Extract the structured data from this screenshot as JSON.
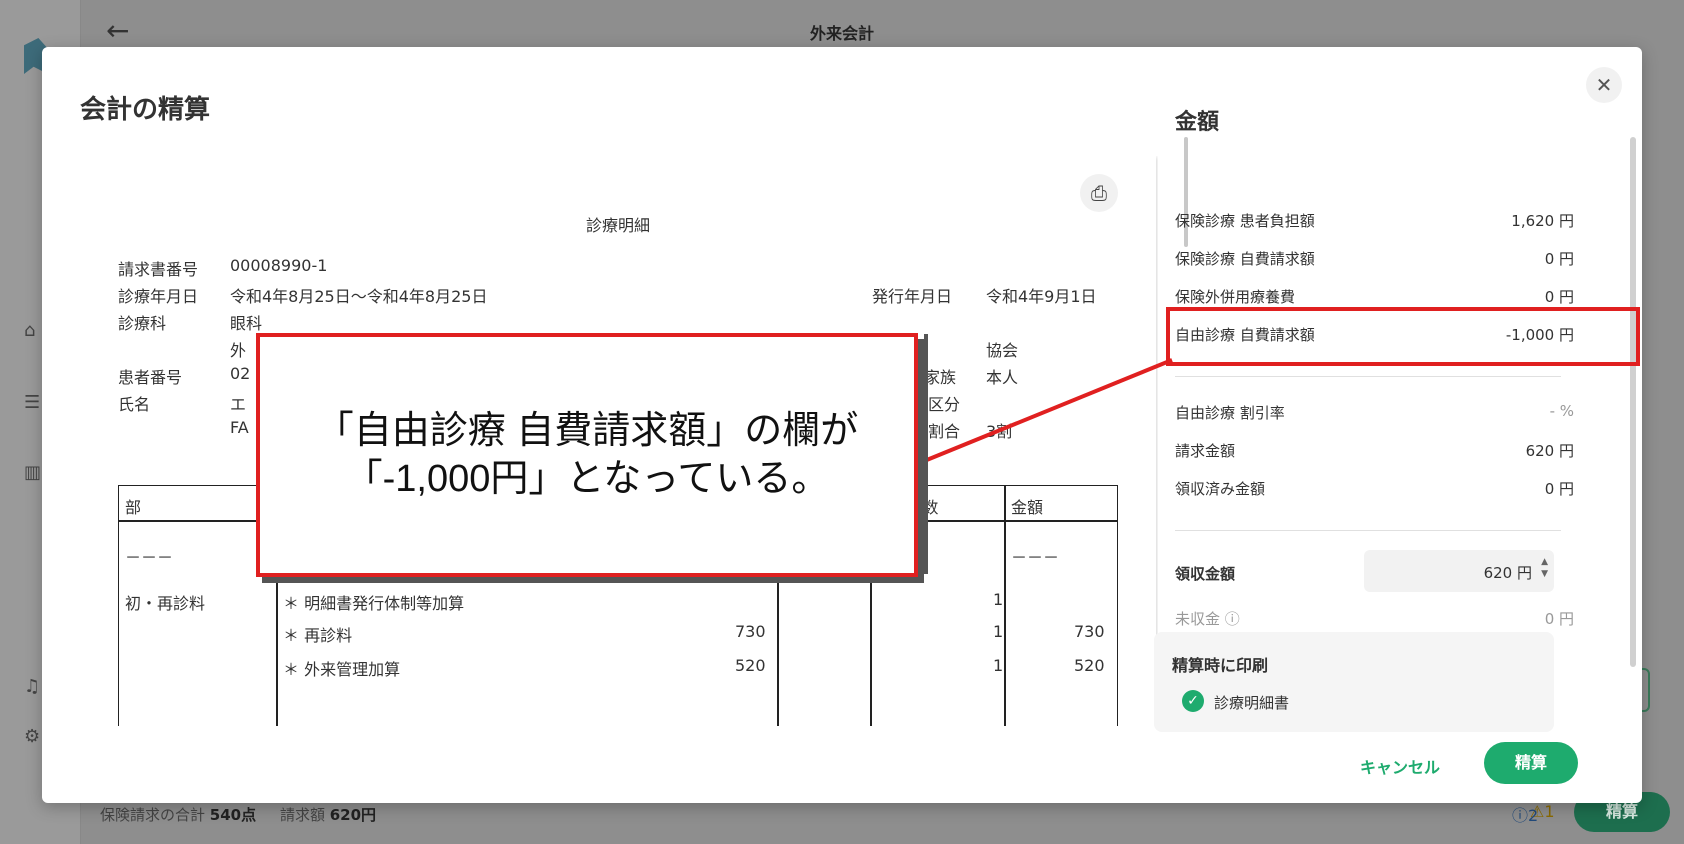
{
  "background": {
    "title": "外来会計",
    "footer": {
      "claim_total_label": "保険請求の合計",
      "claim_total_value": "540点",
      "billed_label": "請求額",
      "billed_value": "620円",
      "warn_count": "1",
      "info_count": "2",
      "settle_label": "精算"
    }
  },
  "modal": {
    "title": "会計の精算",
    "close_icon": "✕"
  },
  "document": {
    "heading": "診療明細",
    "invoice_no_label": "請求書番号",
    "invoice_no": "00008990-1",
    "date_label": "診療年月日",
    "date_value": "令和4年8月25日〜令和4年8月25日",
    "issue_label": "発行年月日",
    "issue_value": "令和4年9月1日",
    "dept_label": "診療科",
    "dept_value": "眼科",
    "dept_value2": "外",
    "kyokai": "協会",
    "patient_no_label": "患者番号",
    "patient_no_partial": "02",
    "family_label": "・家族",
    "family_value": "本人",
    "name_label": "氏名",
    "name_partial": "エ",
    "name_partial2": "FA",
    "kubun": "区分",
    "ratio_label": "割合",
    "ratio_value": "3割",
    "table": {
      "col1": "部",
      "col_count": "/回数",
      "col_amount": "金額",
      "dash": "－－－",
      "rows": [
        {
          "section": "初・再診料",
          "item": "＊ 明細書発行体制等加算",
          "points": "",
          "count": "1",
          "amount": ""
        },
        {
          "section": "",
          "item": "＊ 再診料",
          "points": "730",
          "count": "1",
          "amount": "730"
        },
        {
          "section": "",
          "item": "＊ 外来管理加算",
          "points": "520",
          "count": "1",
          "amount": "520"
        }
      ]
    }
  },
  "amounts": {
    "title": "金額",
    "items": [
      {
        "label": "保険診療 患者負担額",
        "value": "1,620 円"
      },
      {
        "label": "保険診療 自費請求額",
        "value": "0 円"
      },
      {
        "label": "保険外併用療養費",
        "value": "0 円"
      },
      {
        "label": "自由診療 自費請求額",
        "value": "-1,000 円"
      },
      {
        "label": "自由診療 割引率",
        "value": "- %"
      },
      {
        "label": "請求金額",
        "value": "620 円"
      },
      {
        "label": "領収済み金額",
        "value": "0 円"
      }
    ],
    "receipt_label": "領収金額",
    "receipt_value": "620 円",
    "unpaid_label": "未収金",
    "unpaid_value": "0 円",
    "print_title": "精算時に印刷",
    "print_option": "診療明細書"
  },
  "actions": {
    "cancel": "キャンセル",
    "settle": "精算"
  },
  "callout": {
    "line1": "「自由診療 自費請求額」の欄が",
    "line2": "「-1,000円」となっている。"
  },
  "colors": {
    "accent": "#1eab6e",
    "highlight": "#e02020"
  }
}
